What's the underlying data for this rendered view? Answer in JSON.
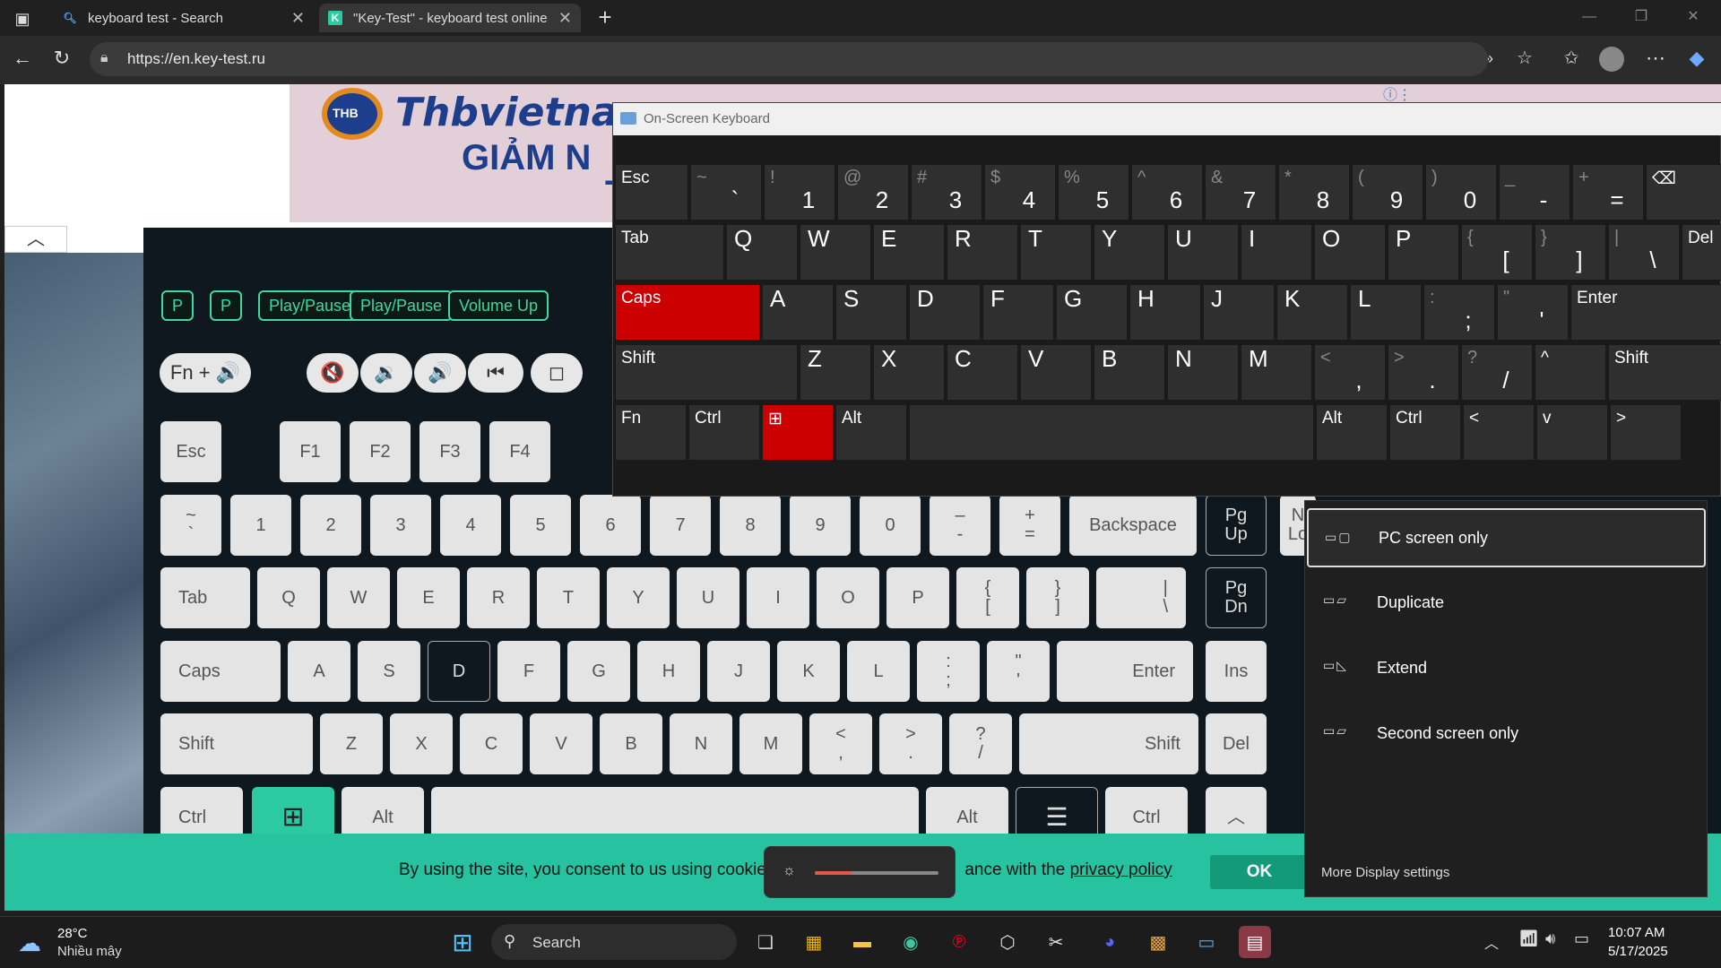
{
  "browser": {
    "tabs": [
      {
        "title": "keyboard test - Search",
        "icon": "search-icon"
      },
      {
        "title": "\"Key-Test\" - keyboard test online",
        "icon": "k-logo-icon"
      }
    ],
    "url": "https://en.key-test.ru"
  },
  "banner": {
    "brand": "Thbvietna",
    "line1": "GIẢM N",
    "line2": "T",
    "logo_text": "THB"
  },
  "history": [
    "P",
    "P",
    "Play/Pause",
    "Play/Pause",
    "Volume Up"
  ],
  "media": {
    "fn_label": "Fn + 🔊",
    "buttons": [
      "🔇",
      "🔉",
      "🔊",
      "⏮",
      "◻"
    ]
  },
  "webkeys": {
    "row0": [
      "Esc",
      "F1",
      "F2",
      "F3",
      "F4"
    ],
    "row1": [
      "~\n`",
      "1",
      "2",
      "3",
      "4",
      "5",
      "6",
      "7",
      "8",
      "9",
      "0",
      "–\n-",
      "+\n=",
      "Backspace",
      "Pg\nUp",
      "N\nLo"
    ],
    "row2": [
      "Tab",
      "Q",
      "W",
      "E",
      "R",
      "T",
      "Y",
      "U",
      "I",
      "O",
      "P",
      "{\n[",
      "}\n]",
      "|\n\\",
      "Pg\nDn"
    ],
    "row3": [
      "Caps",
      "A",
      "S",
      "D",
      "F",
      "G",
      "H",
      "J",
      "K",
      "L",
      ":\n;",
      "\"\n'",
      "Enter",
      "Ins"
    ],
    "row4": [
      "Shift",
      "Z",
      "X",
      "C",
      "V",
      "B",
      "N",
      "M",
      "<\n,",
      ">\n.",
      "?\n/",
      "Shift",
      "Del"
    ],
    "row5": [
      "Ctrl",
      "Alt",
      "Alt",
      "Ctrl"
    ]
  },
  "cookie": {
    "text_before": "By using the site, you consent to us using cookies",
    "text_after": "ance with the ",
    "link": "privacy policy",
    "ok": "OK"
  },
  "osk": {
    "title": "On-Screen Keyboard",
    "row1": [
      [
        "",
        "Esc"
      ],
      [
        "~",
        "`"
      ],
      [
        "!",
        "1"
      ],
      [
        "@",
        "2"
      ],
      [
        "#",
        "3"
      ],
      [
        "$",
        "4"
      ],
      [
        "%",
        "5"
      ],
      [
        "^",
        "6"
      ],
      [
        "&",
        "7"
      ],
      [
        "*",
        "8"
      ],
      [
        "(",
        "9"
      ],
      [
        ")",
        "0"
      ],
      [
        "_",
        "-"
      ],
      [
        "+",
        "="
      ],
      [
        "",
        "⌫"
      ]
    ],
    "row2": [
      [
        "",
        "Tab"
      ],
      [
        "",
        "Q"
      ],
      [
        "",
        "W"
      ],
      [
        "",
        "E"
      ],
      [
        "",
        "R"
      ],
      [
        "",
        "T"
      ],
      [
        "",
        "Y"
      ],
      [
        "",
        "U"
      ],
      [
        "",
        "I"
      ],
      [
        "",
        "O"
      ],
      [
        "",
        "P"
      ],
      [
        "{",
        "["
      ],
      [
        "}",
        "]"
      ],
      [
        "|",
        "\\"
      ],
      [
        "",
        "Del"
      ]
    ],
    "row3": [
      [
        "",
        "Caps"
      ],
      [
        "",
        "A"
      ],
      [
        "",
        "S"
      ],
      [
        "",
        "D"
      ],
      [
        "",
        "F"
      ],
      [
        "",
        "G"
      ],
      [
        "",
        "H"
      ],
      [
        "",
        "J"
      ],
      [
        "",
        "K"
      ],
      [
        "",
        "L"
      ],
      [
        ":",
        ";"
      ],
      [
        "\"",
        "'"
      ],
      [
        "",
        "Enter"
      ]
    ],
    "row4": [
      [
        "",
        "Shift"
      ],
      [
        "",
        "Z"
      ],
      [
        "",
        "X"
      ],
      [
        "",
        "C"
      ],
      [
        "",
        "V"
      ],
      [
        "",
        "B"
      ],
      [
        "",
        "N"
      ],
      [
        "",
        "M"
      ],
      [
        "<",
        ","
      ],
      [
        ">",
        "."
      ],
      [
        "?",
        "/"
      ],
      [
        "",
        "^"
      ],
      [
        "",
        "Shift"
      ]
    ],
    "row5": [
      [
        "",
        "Fn"
      ],
      [
        "",
        "Ctrl"
      ],
      [
        "",
        "⊞"
      ],
      [
        "",
        "Alt"
      ],
      [
        "",
        ""
      ],
      [
        "",
        "Alt"
      ],
      [
        "",
        "Ctrl"
      ],
      [
        "",
        "<"
      ],
      [
        "",
        "v"
      ],
      [
        "",
        ">"
      ]
    ]
  },
  "project": {
    "options": [
      {
        "label": "PC screen only",
        "icon": "▭▢",
        "selected": true
      },
      {
        "label": "Duplicate",
        "icon": "▭▱"
      },
      {
        "label": "Extend",
        "icon": "▭◺"
      },
      {
        "label": "Second screen only",
        "icon": "▭▱"
      }
    ],
    "more": "More Display settings"
  },
  "taskbar": {
    "weather_temp": "28°C",
    "weather_desc": "Nhiều mây",
    "search": "Search",
    "time": "10:07 AM",
    "date": "5/17/2025"
  },
  "colors": {
    "accent": "#2bcaa0",
    "osk_red": "#cc0000"
  }
}
